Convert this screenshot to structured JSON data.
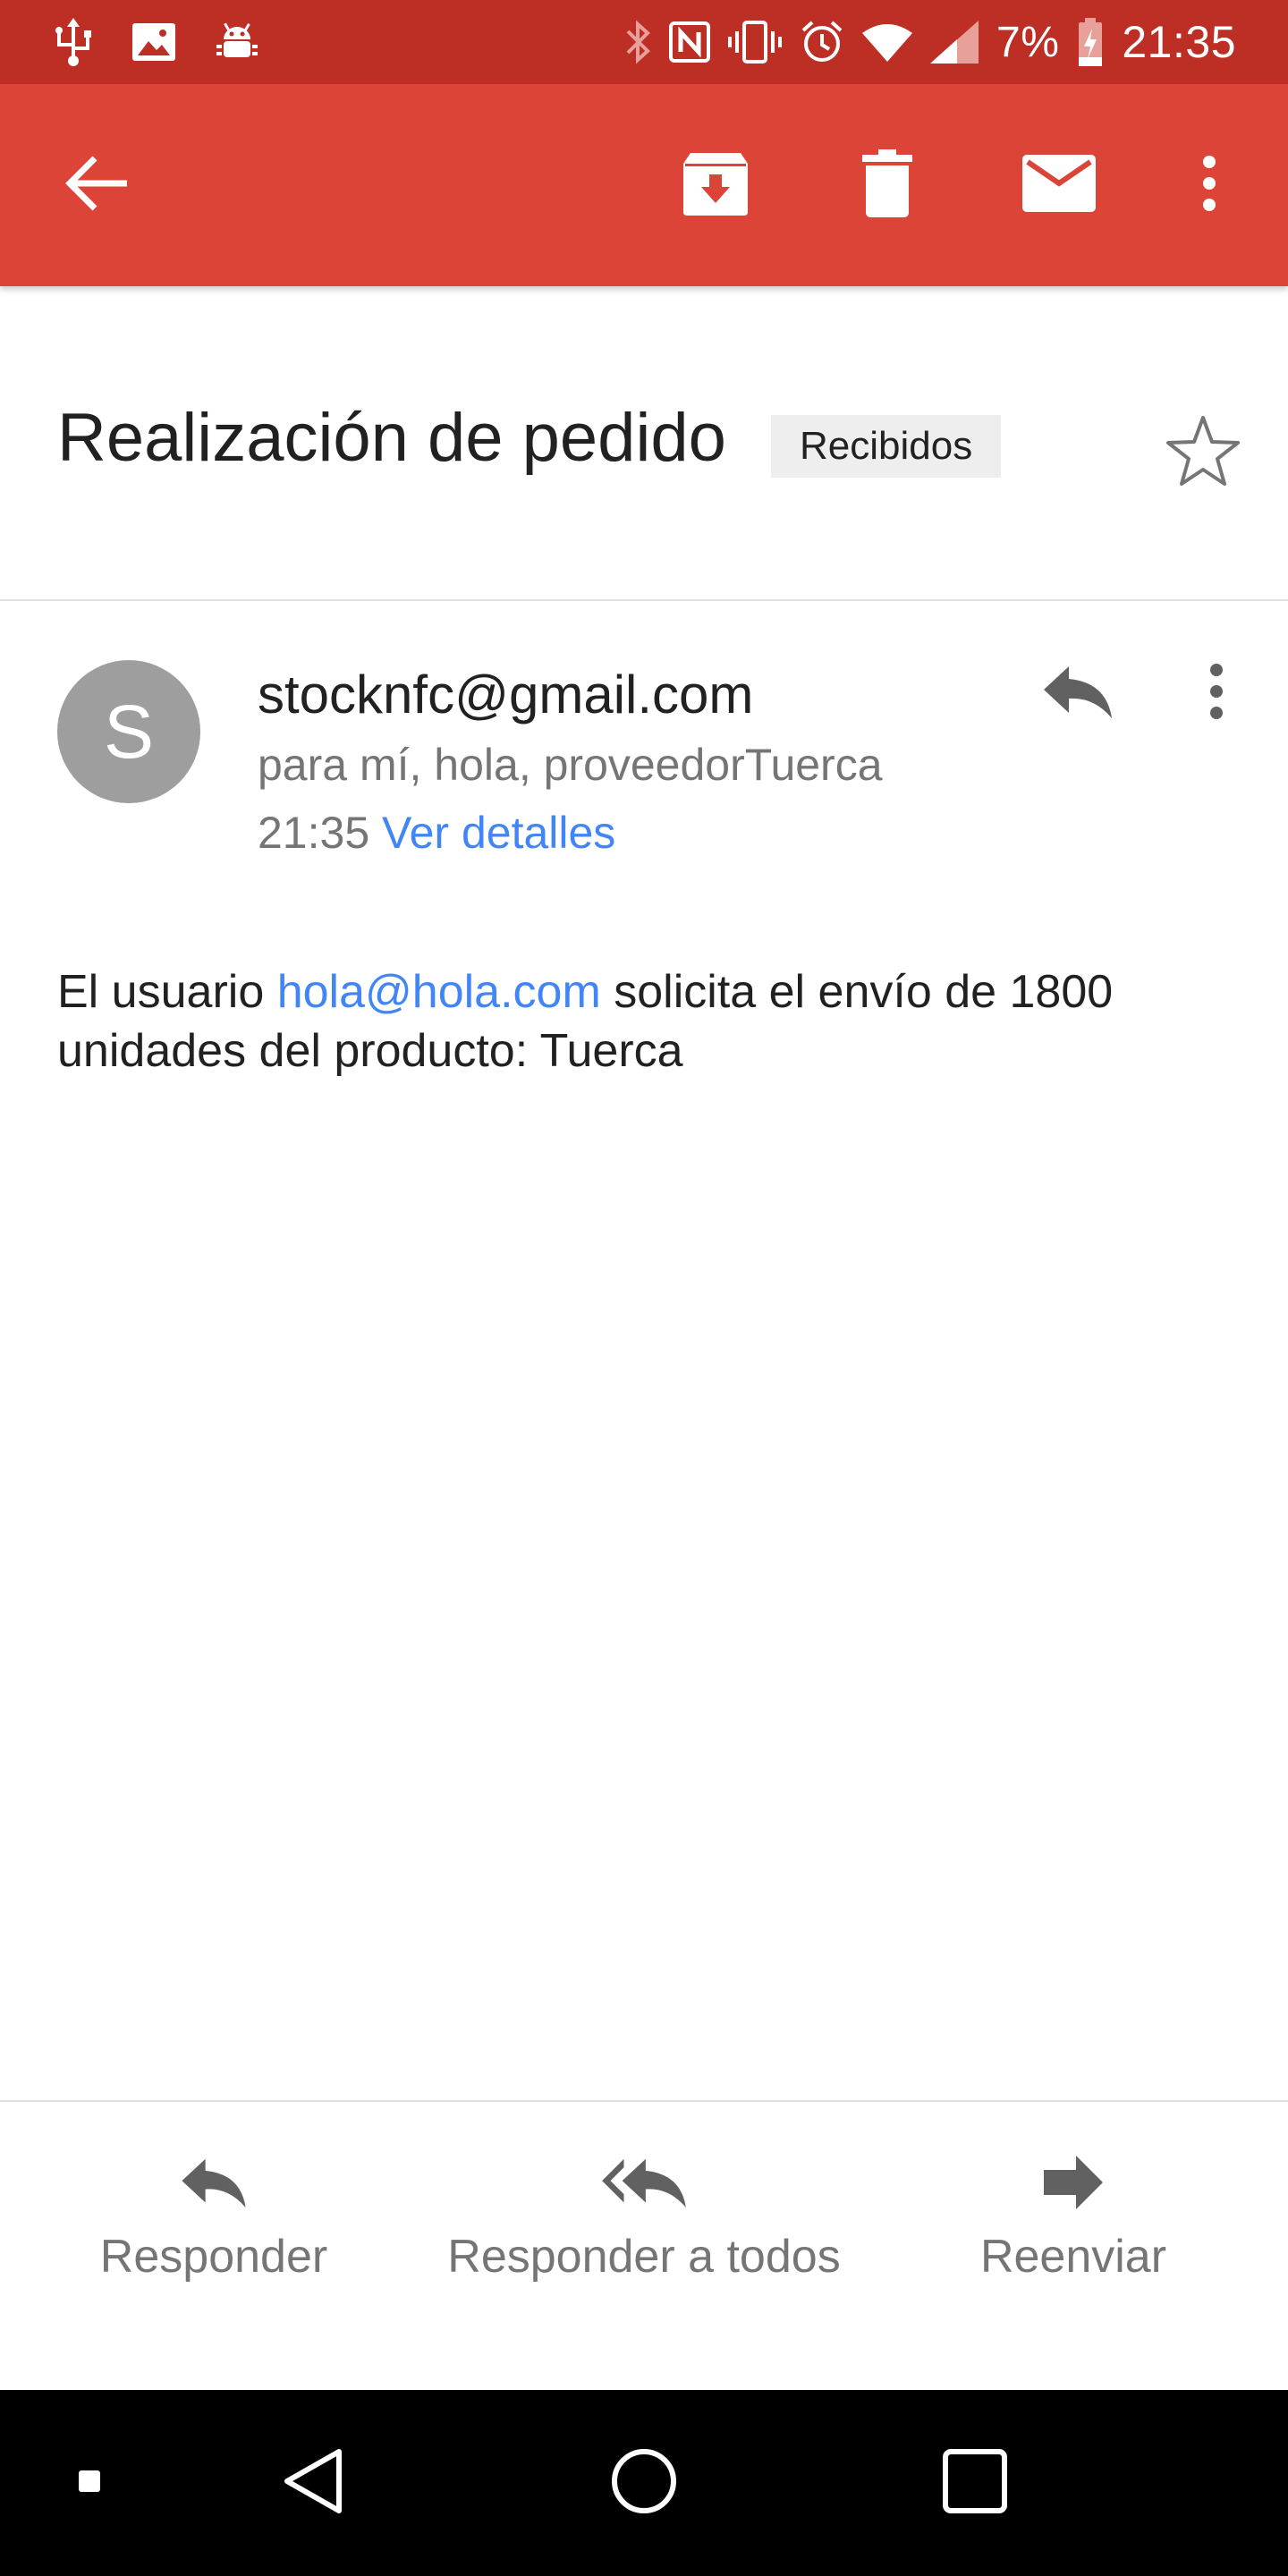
{
  "status_bar": {
    "battery_percent": "7%",
    "time": "21:35",
    "left_icons": [
      "usb-icon",
      "image-icon",
      "android-debug-icon"
    ],
    "right_icons": [
      "bluetooth-icon",
      "nfc-icon",
      "vibrate-icon",
      "alarm-icon",
      "wifi-icon",
      "signal-icon",
      "battery-charging-icon"
    ]
  },
  "app_bar": {
    "color": "#db4437",
    "icons": [
      "back-arrow-icon",
      "archive-icon",
      "delete-icon",
      "mark-unread-icon",
      "more-vert-icon"
    ]
  },
  "email": {
    "subject": "Realización de pedido",
    "label": "Recibidos",
    "sender_initial": "S",
    "sender": "stocknfc@gmail.com",
    "recipients": "para mí, hola, proveedorTuerca",
    "time": "21:35",
    "details_link": "Ver detalles",
    "body": {
      "prefix": "El usuario ",
      "link": "hola@hola.com",
      "suffix": " solicita el envío de 1800 unidades del producto: Tuerca"
    }
  },
  "actions": {
    "reply": "Responder",
    "reply_all": "Responder a todos",
    "forward": "Reenviar"
  },
  "colors": {
    "status_bar": "#bd2f24",
    "app_bar": "#db4437",
    "link": "#4285f4",
    "avatar": "#9e9e9e"
  }
}
